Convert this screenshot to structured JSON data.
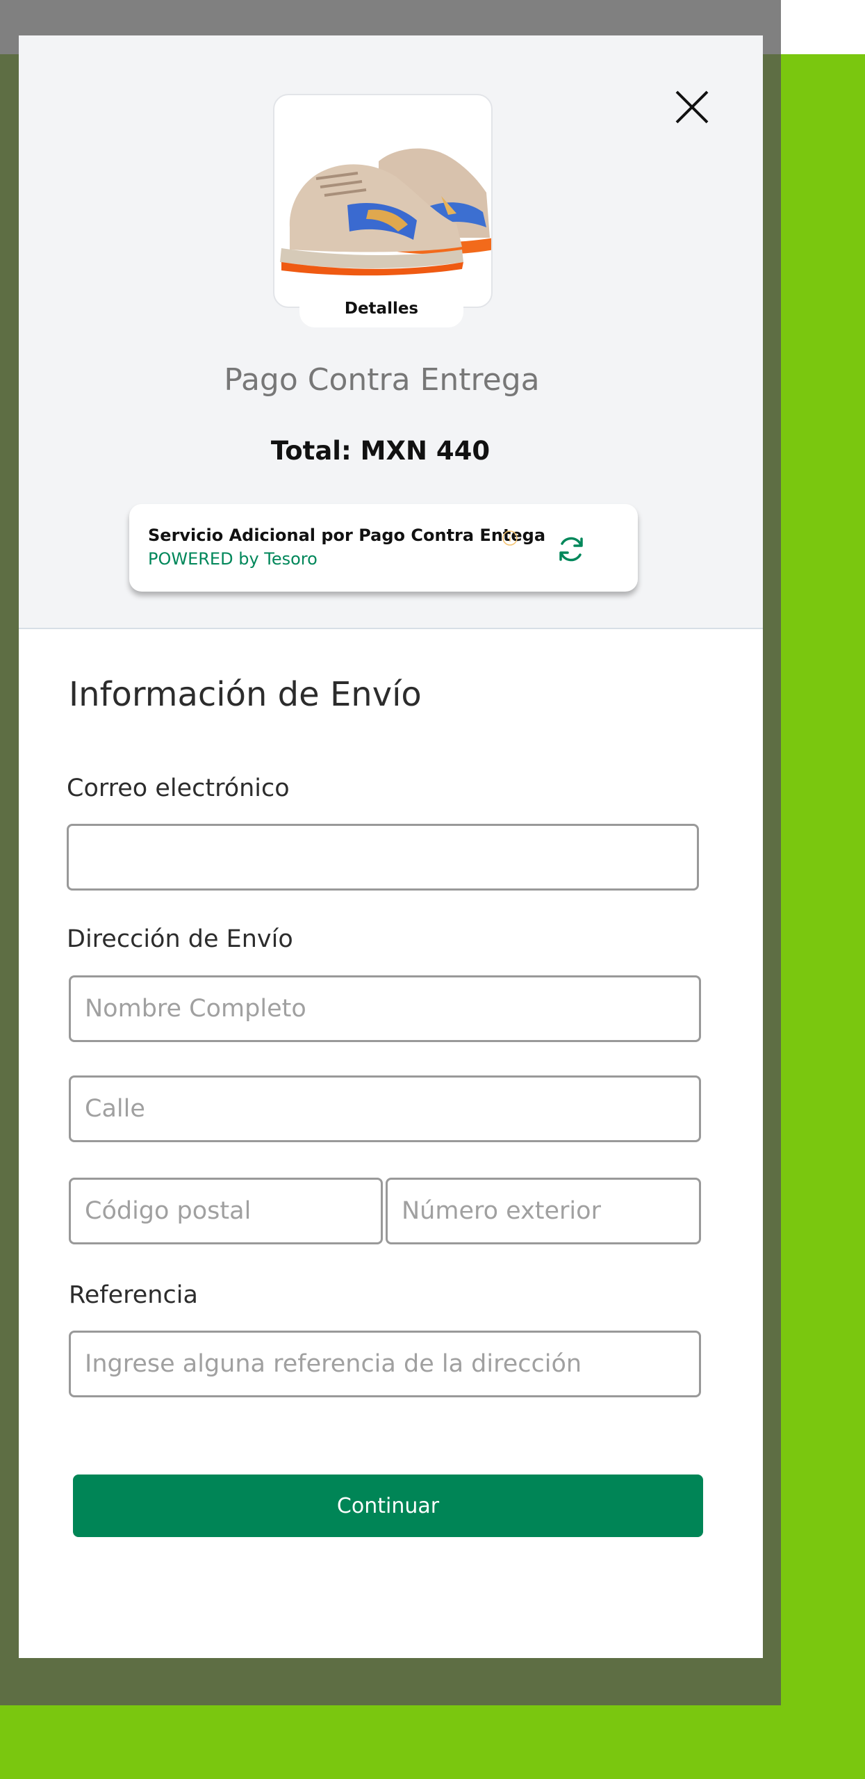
{
  "colors": {
    "backdrop": "#7ac70f",
    "overlay": "#5e6e44",
    "accent_green": "#008556",
    "info_icon": "#f5c470"
  },
  "product": {
    "image_icon": "sneakers-image",
    "details_label": "Detalles"
  },
  "header": {
    "title": "Pago Contra Entrega",
    "total": "Total: MXN 440",
    "close_icon": "close-icon"
  },
  "service": {
    "title": "Servicio Adicional por Pago Contra Entega",
    "powered": "POWERED by Tesoro",
    "info_icon": "info-icon",
    "refresh_icon": "refresh-icon"
  },
  "form": {
    "section_title": "Información de Envío",
    "email_label": "Correo electrónico",
    "email_value": "",
    "email_placeholder": "",
    "address_label": "Dirección de Envío",
    "fullname_placeholder": "Nombre Completo",
    "street_placeholder": "Calle",
    "zip_placeholder": "Código postal",
    "number_placeholder": "Número exterior",
    "reference_label": "Referencia",
    "reference_placeholder": "Ingrese alguna referencia de la dirección",
    "continue_label": "Continuar"
  }
}
